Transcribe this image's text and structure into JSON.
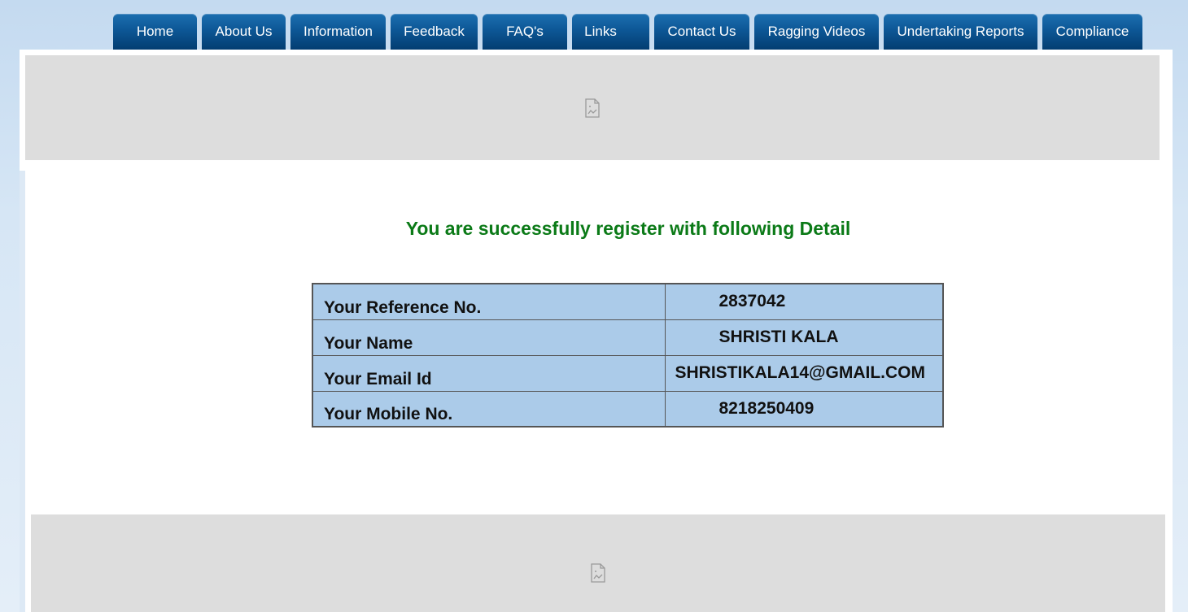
{
  "nav": {
    "tabs": [
      {
        "label": "Home"
      },
      {
        "label": "About Us"
      },
      {
        "label": "Information"
      },
      {
        "label": "Feedback"
      },
      {
        "label": "FAQ's"
      },
      {
        "label": "Links"
      },
      {
        "label": "Contact Us"
      },
      {
        "label": "Ragging Videos"
      },
      {
        "label": "Undertaking Reports"
      },
      {
        "label": "Compliance"
      }
    ]
  },
  "banners": {
    "top_icon": "broken-image-icon",
    "bottom_icon": "broken-image-icon"
  },
  "success": {
    "message": "You are successfully register with following Detail"
  },
  "details": {
    "rows": [
      {
        "label": "Your Reference No.",
        "value": "2837042"
      },
      {
        "label": "Your Name",
        "value": "SHRISTI KALA"
      },
      {
        "label": "Your Email Id",
        "value": "SHRISTIKALA14@GMAIL.COM"
      },
      {
        "label": "Your Mobile No.",
        "value": "8218250409"
      }
    ]
  },
  "colors": {
    "tab_bg": "#0d5796",
    "success_text": "#0b7a17",
    "table_bg": "#abcbe9",
    "placeholder_bg": "#dddddd"
  }
}
